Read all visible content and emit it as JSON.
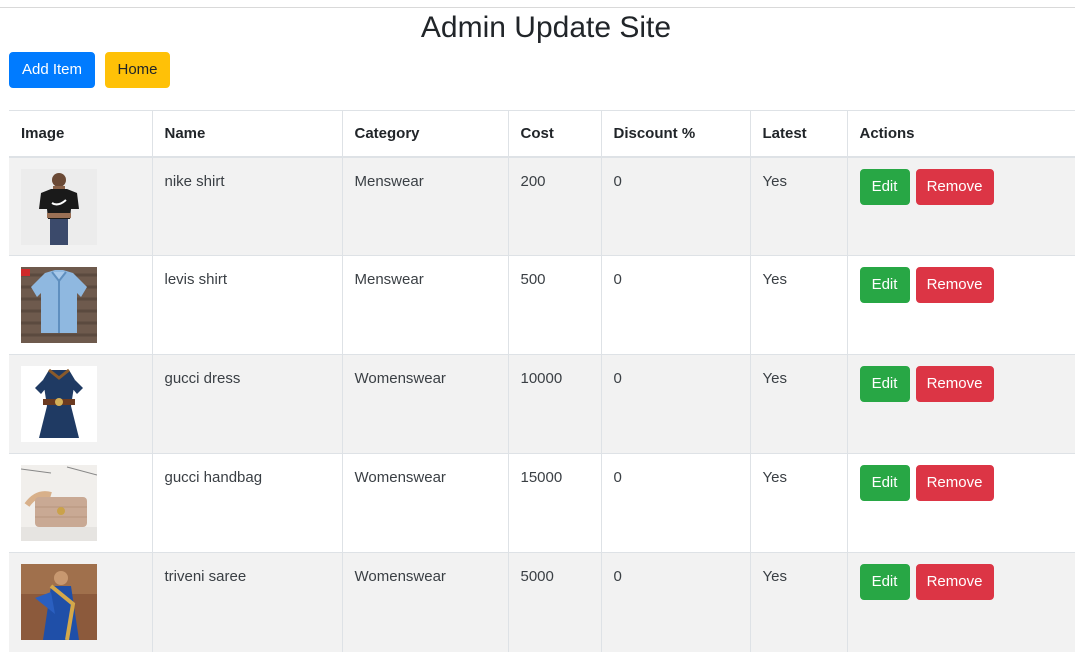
{
  "page": {
    "title": "Admin Update Site"
  },
  "toolbar": {
    "add_label": "Add Item",
    "home_label": "Home"
  },
  "table": {
    "headers": [
      "Image",
      "Name",
      "Category",
      "Cost",
      "Discount %",
      "Latest",
      "Actions"
    ],
    "rows": [
      {
        "image": "black-nike-tshirt-image",
        "name": "nike shirt",
        "category": "Menswear",
        "cost": "200",
        "discount": "0",
        "latest": "Yes",
        "edit": "Edit",
        "remove": "Remove"
      },
      {
        "image": "blue-denim-shirt-image",
        "name": "levis shirt",
        "category": "Menswear",
        "cost": "500",
        "discount": "0",
        "latest": "Yes",
        "edit": "Edit",
        "remove": "Remove"
      },
      {
        "image": "navy-gucci-dress-image",
        "name": "gucci dress",
        "category": "Womenswear",
        "cost": "10000",
        "discount": "0",
        "latest": "Yes",
        "edit": "Edit",
        "remove": "Remove"
      },
      {
        "image": "tan-gucci-handbag-image",
        "name": "gucci handbag",
        "category": "Womenswear",
        "cost": "15000",
        "discount": "0",
        "latest": "Yes",
        "edit": "Edit",
        "remove": "Remove"
      },
      {
        "image": "blue-saree-image",
        "name": "triveni saree",
        "category": "Womenswear",
        "cost": "5000",
        "discount": "0",
        "latest": "Yes",
        "edit": "Edit",
        "remove": "Remove"
      }
    ]
  },
  "colors": {
    "primary": "#007bff",
    "warning": "#ffc107",
    "success": "#28a745",
    "danger": "#dc3545",
    "stripe": "#f2f2f2"
  }
}
